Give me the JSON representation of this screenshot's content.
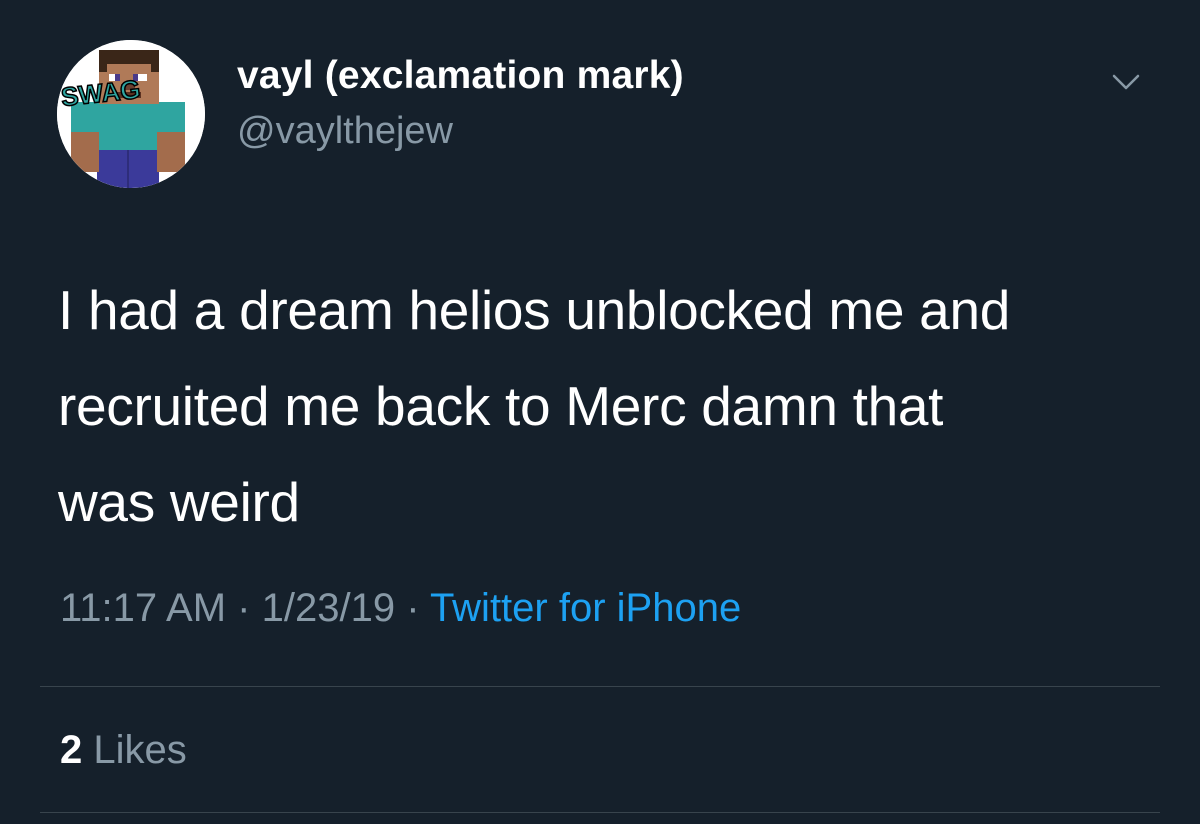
{
  "author": {
    "display_name": "vayl (exclamation mark)",
    "handle": "@vaylthejew",
    "avatar": {
      "icon": "minecraft-steve-avatar",
      "overlay_text": "SWAG"
    }
  },
  "menu": {
    "icon": "chevron-down-icon"
  },
  "tweet": {
    "lines": [
      "I had a dream helios unblocked me and",
      "recruited me back to Merc damn that",
      "was weird"
    ],
    "time": "11:17 AM",
    "separator": "·",
    "date": "1/23/19",
    "source": "Twitter for iPhone"
  },
  "stats": {
    "likes_count": "2",
    "likes_label": "Likes"
  },
  "colors": {
    "background": "#15202b",
    "secondary_text": "#8899a6",
    "link": "#1da1f2",
    "divider": "#38444d"
  }
}
